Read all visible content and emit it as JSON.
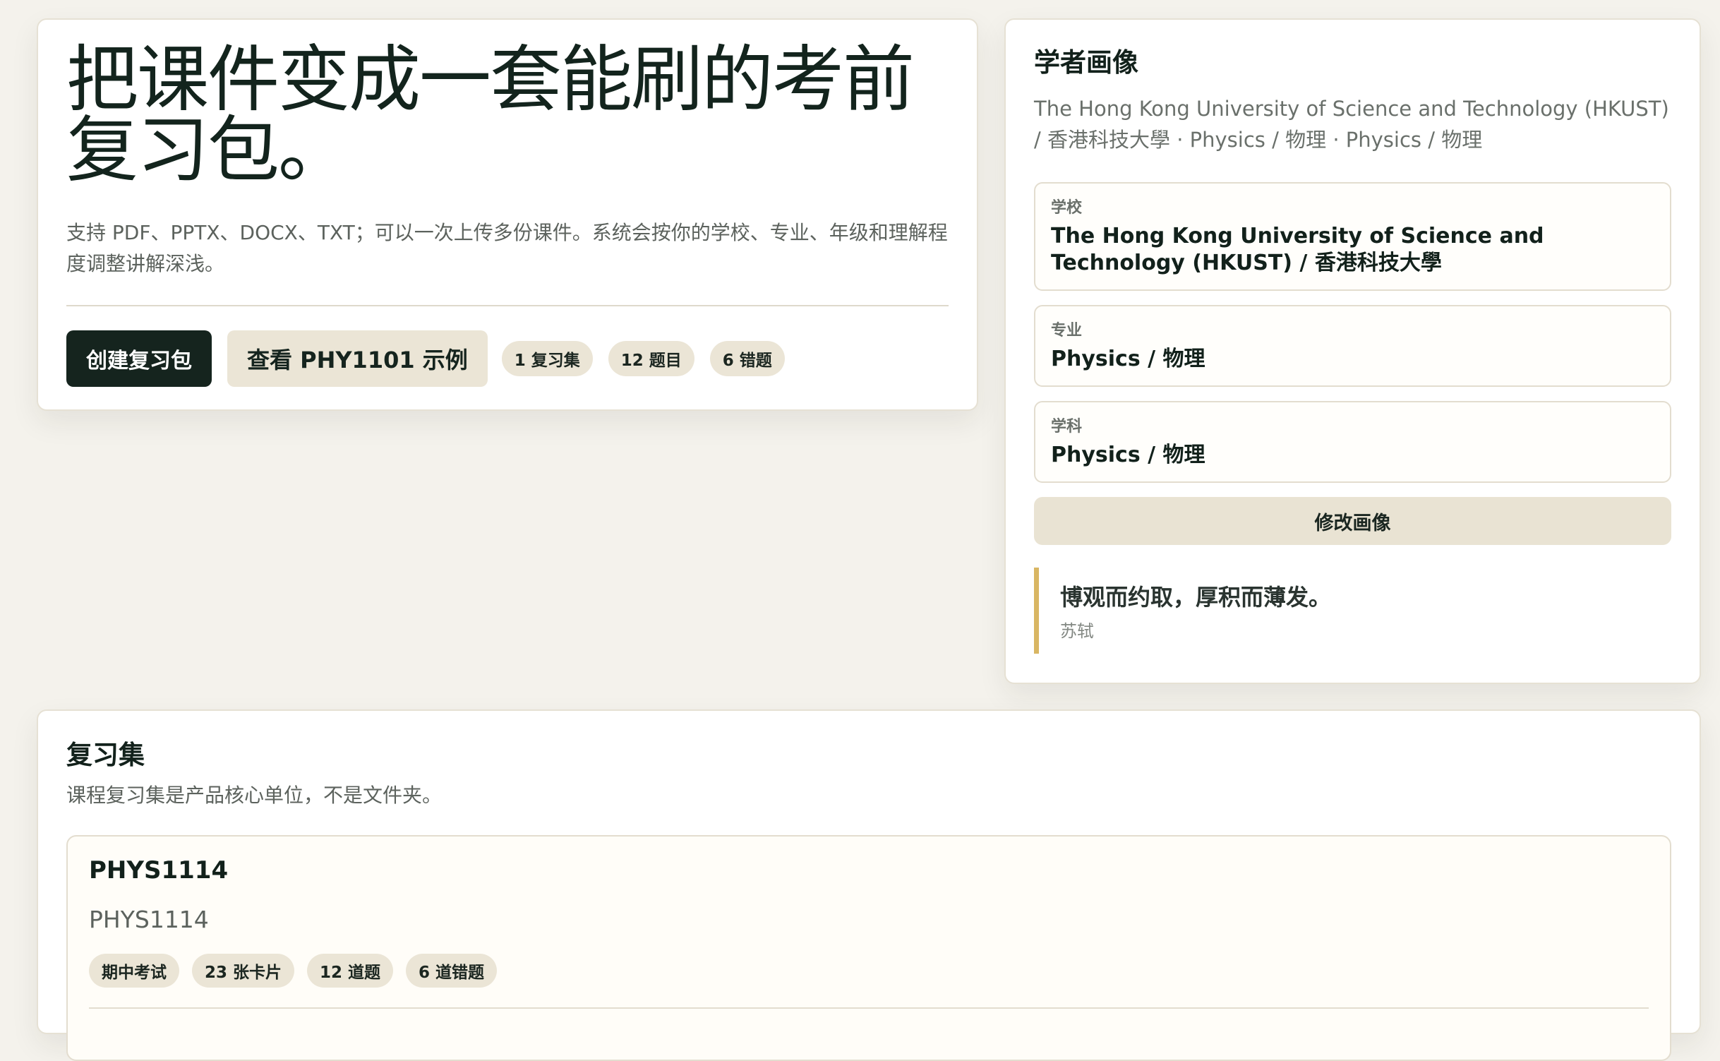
{
  "hero": {
    "title": "把课件变成一套能刷的考前复习包。",
    "subtitle": "支持 PDF、PPTX、DOCX、TXT；可以一次上传多份课件。系统会按你的学校、专业、年级和理解程度调整讲解深浅。",
    "primary_button": "创建复习包",
    "secondary_button": "查看 PHY1101 示例",
    "stats": [
      "1 复习集",
      "12 题目",
      "6 错题"
    ]
  },
  "profile": {
    "title": "学者画像",
    "summary": "The Hong Kong University of Science and Technology (HKUST) / 香港科技大學 · Physics / 物理 · Physics / 物理",
    "fields": [
      {
        "label": "学校",
        "value": "The Hong Kong University of Science and Technology (HKUST) / 香港科技大學"
      },
      {
        "label": "专业",
        "value": "Physics / 物理"
      },
      {
        "label": "学科",
        "value": "Physics / 物理"
      }
    ],
    "edit_button": "修改画像",
    "quote": {
      "text": "博观而约取，厚积而薄发。",
      "author": "苏轼"
    }
  },
  "sets": {
    "title": "复习集",
    "description": "课程复习集是产品核心单位，不是文件夹。",
    "items": [
      {
        "code": "PHYS1114",
        "name": "PHYS1114",
        "tags": [
          "期中考试",
          "23 张卡片",
          "12 道题",
          "6 道错题"
        ]
      }
    ]
  },
  "colors": {
    "background": "#f4f2ec",
    "primary": "#15241e",
    "chip": "#ebe5d6",
    "quote_accent": "#d9b663"
  }
}
